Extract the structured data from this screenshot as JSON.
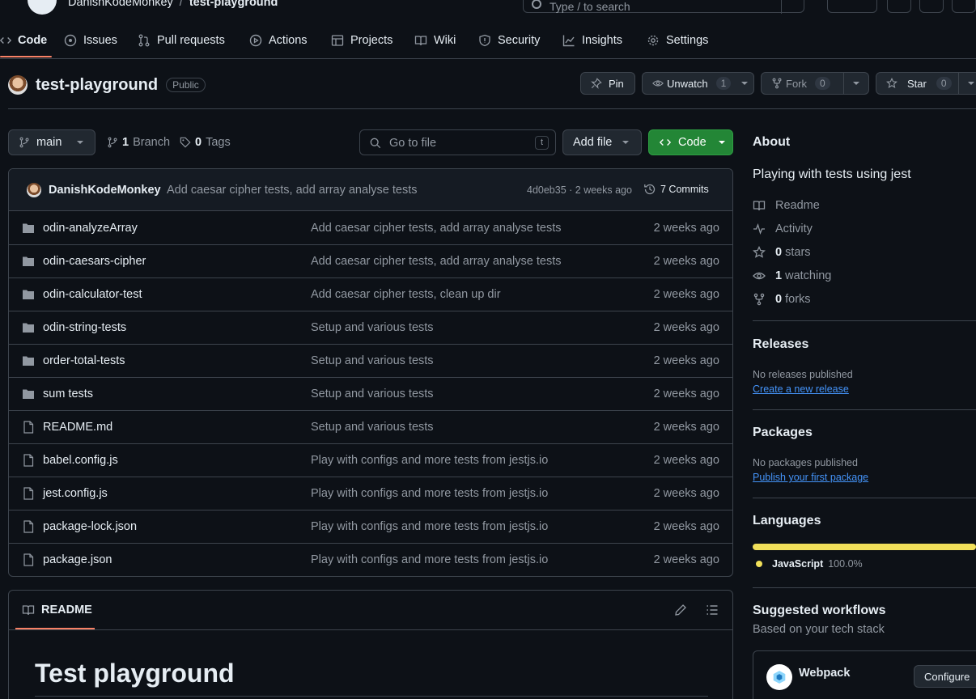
{
  "header": {
    "owner": "DanishKodeMonkey",
    "slash": "/",
    "repo": "test-playground",
    "search_placeholder": "Type / to search"
  },
  "tabs": [
    {
      "label": "Code",
      "icon": "code-icon",
      "active": true
    },
    {
      "label": "Issues",
      "icon": "issue-icon"
    },
    {
      "label": "Pull requests",
      "icon": "pull-request-icon"
    },
    {
      "label": "Actions",
      "icon": "play-icon"
    },
    {
      "label": "Projects",
      "icon": "table-icon"
    },
    {
      "label": "Wiki",
      "icon": "book-icon"
    },
    {
      "label": "Security",
      "icon": "shield-icon"
    },
    {
      "label": "Insights",
      "icon": "graph-icon"
    },
    {
      "label": "Settings",
      "icon": "gear-icon"
    }
  ],
  "repo": {
    "name": "test-playground",
    "visibility": "Public",
    "pin_label": "Pin",
    "unwatch_label": "Unwatch",
    "watch_count": "1",
    "fork_label": "Fork",
    "fork_count": "0",
    "star_label": "Star",
    "star_count": "0"
  },
  "toolbar": {
    "branch": "main",
    "branch_count": "1",
    "branch_label": "Branch",
    "tag_count": "0",
    "tag_label": "Tags",
    "goto_placeholder": "Go to file",
    "goto_shortcut": "t",
    "add_file_label": "Add file",
    "code_label": "Code"
  },
  "commit": {
    "author": "DanishKodeMonkey",
    "message": "Add caesar cipher tests, add array analyse tests",
    "hash_time": "4d0eb35 · 2 weeks ago",
    "commits_label": "7 Commits"
  },
  "files": [
    {
      "name": "odin-analyzeArray",
      "type": "dir",
      "message": "Add caesar cipher tests, add array analyse tests",
      "time": "2 weeks ago"
    },
    {
      "name": "odin-caesars-cipher",
      "type": "dir",
      "message": "Add caesar cipher tests, add array analyse tests",
      "time": "2 weeks ago"
    },
    {
      "name": "odin-calculator-test",
      "type": "dir",
      "message": "Add caesar cipher tests, clean up dir",
      "time": "2 weeks ago"
    },
    {
      "name": "odin-string-tests",
      "type": "dir",
      "message": "Setup and various tests",
      "time": "2 weeks ago"
    },
    {
      "name": "order-total-tests",
      "type": "dir",
      "message": "Setup and various tests",
      "time": "2 weeks ago"
    },
    {
      "name": "sum tests",
      "type": "dir",
      "message": "Setup and various tests",
      "time": "2 weeks ago"
    },
    {
      "name": "README.md",
      "type": "file",
      "message": "Setup and various tests",
      "time": "2 weeks ago"
    },
    {
      "name": "babel.config.js",
      "type": "file",
      "message": "Play with configs and more tests from jestjs.io",
      "time": "2 weeks ago"
    },
    {
      "name": "jest.config.js",
      "type": "file",
      "message": "Play with configs and more tests from jestjs.io",
      "time": "2 weeks ago"
    },
    {
      "name": "package-lock.json",
      "type": "file",
      "message": "Play with configs and more tests from jestjs.io",
      "time": "2 weeks ago"
    },
    {
      "name": "package.json",
      "type": "file",
      "message": "Play with configs and more tests from jestjs.io",
      "time": "2 weeks ago"
    }
  ],
  "readme": {
    "tab_label": "README",
    "heading": "Test playground"
  },
  "about": {
    "title": "About",
    "description": "Playing with tests using jest",
    "readme_label": "Readme",
    "activity_label": "Activity",
    "stars_count": "0",
    "stars_label": "stars",
    "watching_count": "1",
    "watching_label": "watching",
    "forks_count": "0",
    "forks_label": "forks"
  },
  "releases": {
    "title": "Releases",
    "none_text": "No releases published",
    "create_link": "Create a new release"
  },
  "packages": {
    "title": "Packages",
    "none_text": "No packages published",
    "publish_link": "Publish your first package"
  },
  "languages": {
    "title": "Languages",
    "items": [
      {
        "name": "JavaScript",
        "percent": "100.0%",
        "fraction": 1.0,
        "color": "#f1e05a"
      }
    ]
  },
  "workflows": {
    "title": "Suggested workflows",
    "subtitle": "Based on your tech stack",
    "card_name": "Webpack",
    "configure_label": "Configure"
  }
}
